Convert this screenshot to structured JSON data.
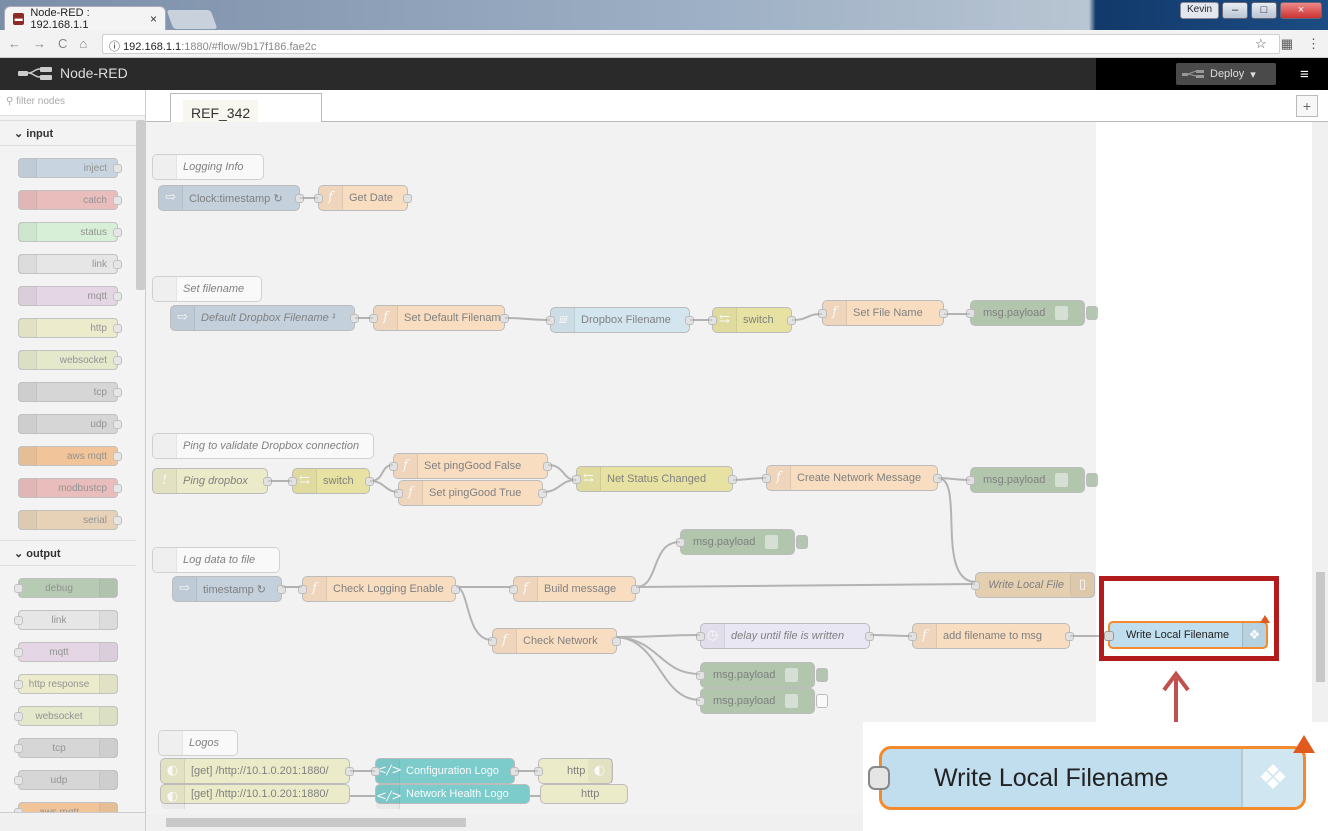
{
  "browser": {
    "tab_title": "Node-RED : 192.168.1.1",
    "tab_close": "×",
    "url_host": "192.168.1.1",
    "url_rest": ":1880/#flow/9b17f186.fae2c",
    "user": "Kevin",
    "back": "←",
    "forward": "→",
    "reload": "C",
    "home": "⌂",
    "info": "ⓘ",
    "star": "☆",
    "ext": "▦",
    "menu": "⋮",
    "min": "–",
    "max": "□",
    "close": "×"
  },
  "app": {
    "name": "Node-RED",
    "deploy": "Deploy",
    "menu_icon": "≡",
    "logo_icon": "node-red-logo-icon"
  },
  "palette": {
    "filter": "filter nodes",
    "categories": [
      {
        "label": "input"
      },
      {
        "label": "output"
      }
    ],
    "input": [
      "inject",
      "catch",
      "status",
      "link",
      "mqtt",
      "http",
      "websocket",
      "tcp",
      "udp",
      "aws mqtt",
      "modbustcp",
      "serial"
    ],
    "input_colors": [
      "#a6bbcf",
      "#e49191",
      "#c0edc0",
      "#dddddd",
      "#d8bfd8",
      "#e7e7ae",
      "#dbe1ad",
      "#c0c0c0",
      "#c0c0c0",
      "#f0a050",
      "#e49191",
      "#deb887"
    ],
    "output": [
      "debug",
      "link",
      "mqtt",
      "http response",
      "websocket",
      "tcp",
      "udp",
      "aws mqtt"
    ],
    "output_colors": [
      "#87a980",
      "#dddddd",
      "#d8bfd8",
      "#e7e7ae",
      "#dbe1ad",
      "#c0c0c0",
      "#c0c0c0",
      "#f0a050"
    ]
  },
  "workspace": {
    "tab": "REF_342",
    "add": "+"
  },
  "comments": [
    "Logging Info",
    "Set filename",
    "Ping to validate Dropbox connection",
    "Log data to file",
    "Logos"
  ],
  "nodes": {
    "clock": "Clock:timestamp ↻",
    "get_date": "Get Date",
    "default_fn": "Default Dropbox Filename ¹",
    "set_default": "Set Default Filename",
    "dropbox_fn": "Dropbox Filename",
    "switch1": "switch",
    "set_file_name": "Set File Name",
    "payload1": "msg.payload",
    "ping": "Ping dropbox",
    "switch2": "switch",
    "set_false": "Set pingGood False",
    "set_true": "Set pingGood True",
    "net_status": "Net Status Changed",
    "create_msg": "Create Network Message",
    "payload2": "msg.payload",
    "timestamp": "timestamp ↻",
    "check_logging": "Check Logging Enable",
    "build_msg": "Build message",
    "payload3": "msg.payload",
    "write_local_file": "Write Local File",
    "check_network": "Check Network",
    "delay": "delay until file is written",
    "add_filename": "add filename to msg",
    "payload4": "msg.payload",
    "payload5": "msg.payload",
    "get1": "[get] /http://10.1.0.201:1880/",
    "config_logo": "Configuration Logo",
    "http1": "http",
    "get2": "[get] /http://10.1.0.201:1880/",
    "network_logo": "Network Health Logo",
    "http2": "http"
  },
  "highlight": {
    "label": "Write Local Filename"
  },
  "zoom": {
    "label": "Write Local Filename"
  },
  "colors": {
    "function": "#fdd0a2",
    "inject": "#a6bbcf",
    "debug": "#87a980",
    "dropbox": "#c0deed",
    "selection_border": "#f38b2c",
    "annotation_red": "#b21c1c"
  }
}
